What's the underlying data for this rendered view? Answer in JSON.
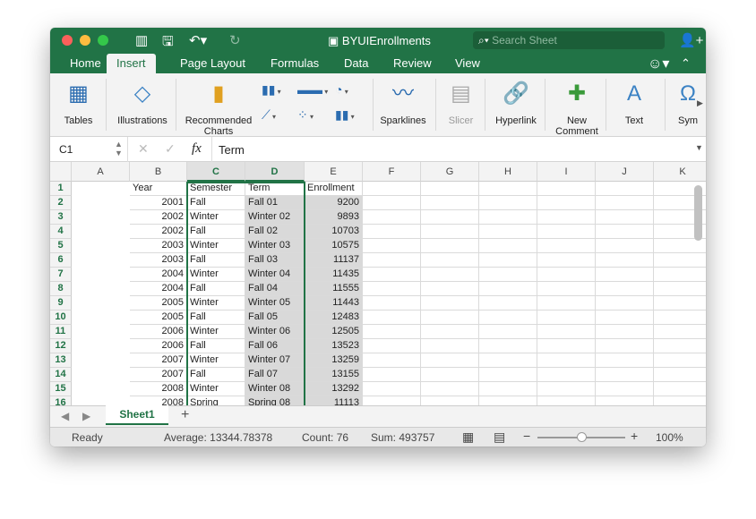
{
  "window": {
    "title": "BYUIEnrollments",
    "search_placeholder": "Search Sheet"
  },
  "tabs": [
    "Home",
    "Insert",
    "Page Layout",
    "Formulas",
    "Data",
    "Review",
    "View"
  ],
  "active_tab": "Insert",
  "ribbon": [
    {
      "label": "Tables",
      "icon": "table-icon"
    },
    {
      "label": "Illustrations",
      "icon": "shapes-icon"
    },
    {
      "label": "Recommended\nCharts",
      "icon": "recommended-charts-icon"
    },
    {
      "label": "Sparklines",
      "icon": "sparklines-icon"
    },
    {
      "label": "Slicer",
      "icon": "slicer-icon",
      "disabled": true
    },
    {
      "label": "Hyperlink",
      "icon": "hyperlink-icon"
    },
    {
      "label": "New\nComment",
      "icon": "new-comment-icon"
    },
    {
      "label": "Text",
      "icon": "text-icon"
    },
    {
      "label": "Sym",
      "icon": "symbol-icon"
    }
  ],
  "formula_bar": {
    "cell_ref": "C1",
    "fx": "fx",
    "value": "Term"
  },
  "columns": [
    "A",
    "B",
    "C",
    "D",
    "E",
    "F",
    "G",
    "H",
    "I",
    "J",
    "K"
  ],
  "selected_columns": [
    "C",
    "D"
  ],
  "rows": [
    [
      "Year",
      "Semester",
      "Term",
      "Enrollment"
    ],
    [
      "2001",
      "Fall",
      "Fall 01",
      "9200"
    ],
    [
      "2002",
      "Winter",
      "Winter 02",
      "9893"
    ],
    [
      "2002",
      "Fall",
      "Fall 02",
      "10703"
    ],
    [
      "2003",
      "Winter",
      "Winter 03",
      "10575"
    ],
    [
      "2003",
      "Fall",
      "Fall 03",
      "11137"
    ],
    [
      "2004",
      "Winter",
      "Winter 04",
      "11435"
    ],
    [
      "2004",
      "Fall",
      "Fall 04",
      "11555"
    ],
    [
      "2005",
      "Winter",
      "Winter 05",
      "11443"
    ],
    [
      "2005",
      "Fall",
      "Fall 05",
      "12483"
    ],
    [
      "2006",
      "Winter",
      "Winter 06",
      "12505"
    ],
    [
      "2006",
      "Fall",
      "Fall 06",
      "13523"
    ],
    [
      "2007",
      "Winter",
      "Winter 07",
      "13259"
    ],
    [
      "2007",
      "Fall",
      "Fall 07",
      "13155"
    ],
    [
      "2008",
      "Winter",
      "Winter 08",
      "13292"
    ],
    [
      "2008",
      "Spring",
      "Spring 08",
      "11113"
    ]
  ],
  "sheets": [
    "Sheet1"
  ],
  "add_sheet": "+",
  "status": {
    "ready": "Ready",
    "average": "Average: 13344.78378",
    "count": "Count: 76",
    "sum": "Sum: 493757",
    "zoom": "100%"
  },
  "colors": {
    "brand": "#217346",
    "selection": "#d9d9d9"
  }
}
